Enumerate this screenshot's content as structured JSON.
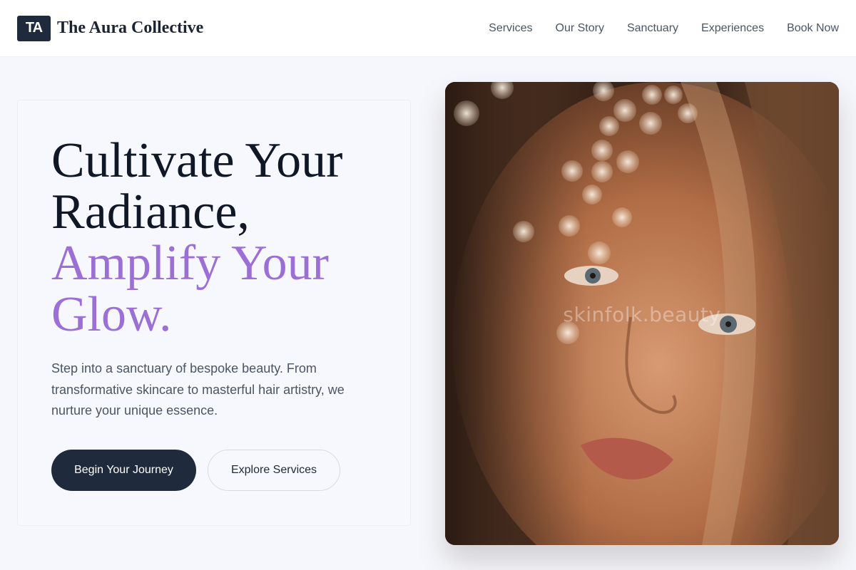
{
  "header": {
    "logo_initials": "TA",
    "brand_name": "The Aura Collective",
    "nav": [
      {
        "label": "Services"
      },
      {
        "label": "Our Story"
      },
      {
        "label": "Sanctuary"
      },
      {
        "label": "Experiences"
      },
      {
        "label": "Book Now"
      }
    ]
  },
  "hero": {
    "headline_line1": "Cultivate Your",
    "headline_line2": "Radiance,",
    "headline_accent_line1": "Amplify Your",
    "headline_accent_line2": "Glow.",
    "lead": "Step into a sanctuary of bespoke beauty. From transformative skincare to masterful hair artistry, we nurture your unique essence.",
    "primary_cta": "Begin Your Journey",
    "secondary_cta": "Explore Services",
    "image_watermark": "skinfolk.beauty"
  },
  "colors": {
    "accent": "#9b6fd6",
    "primary_dark": "#1f2a3c",
    "background": "#f6f7fc"
  }
}
